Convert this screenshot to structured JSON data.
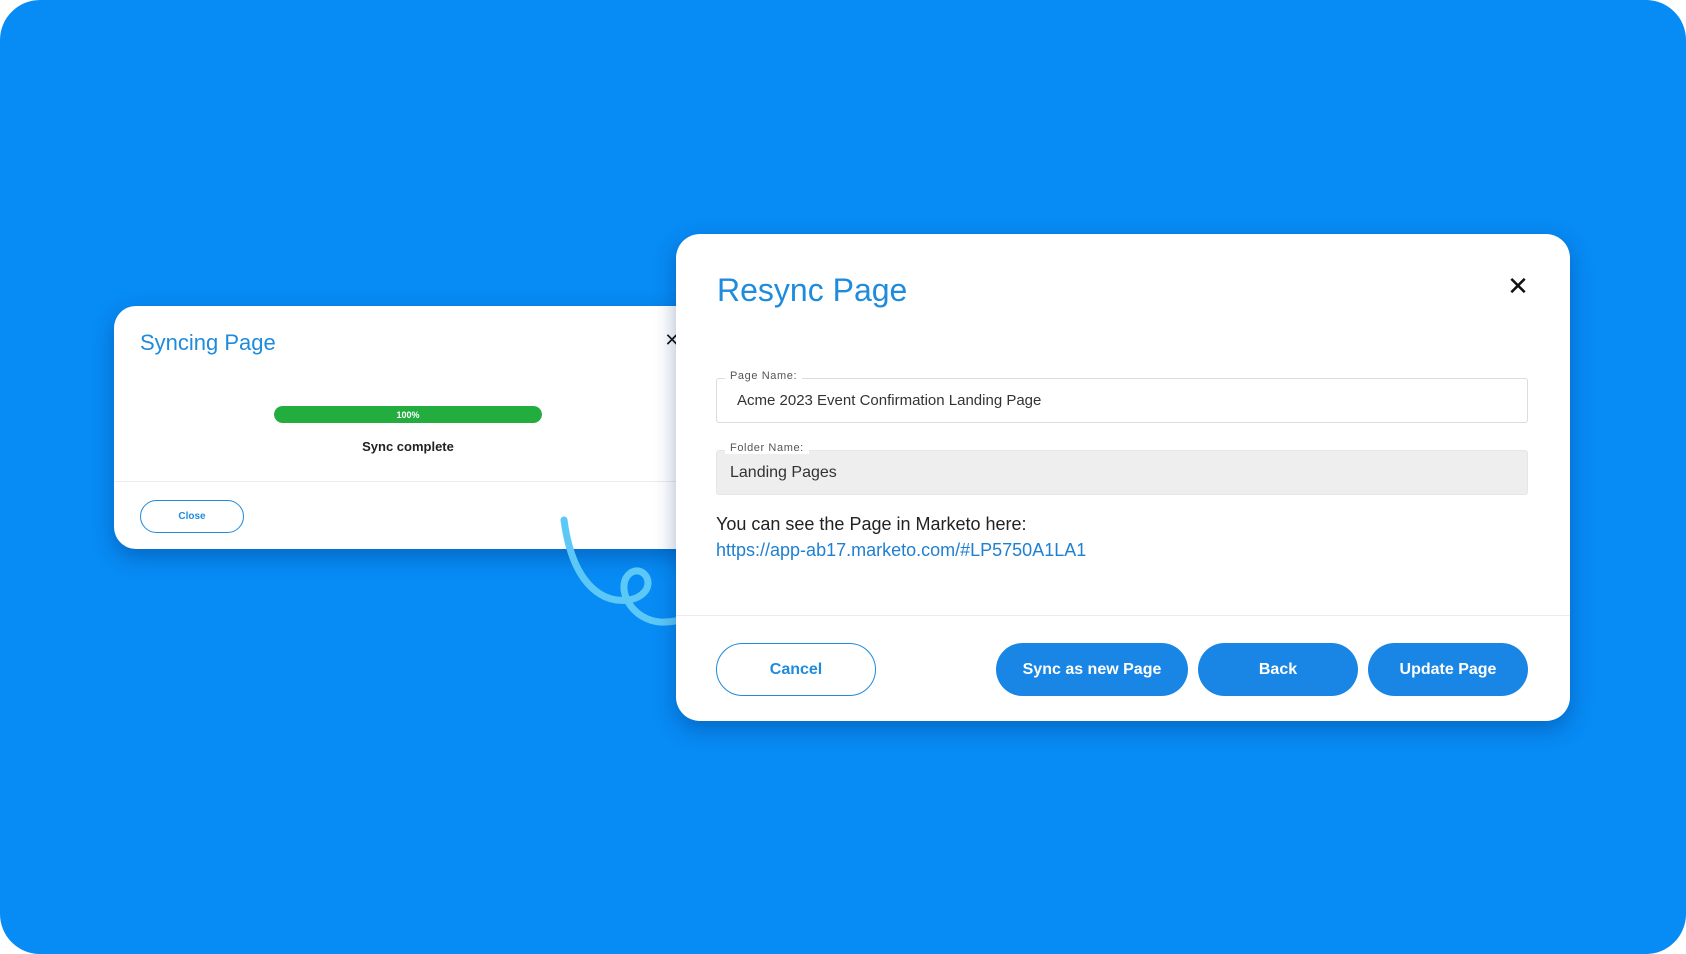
{
  "colors": {
    "background": "#078bf4",
    "accent": "#1f8bdc",
    "button_fill": "#1986e6",
    "progress": "#22ad3e"
  },
  "syncing_dialog": {
    "title": "Syncing Page",
    "progress_label": "100%",
    "progress_fraction": 1.0,
    "status": "Sync complete",
    "close_label": "Close",
    "close_icon": "close-icon"
  },
  "resync_dialog": {
    "title": "Resync Page",
    "close_icon": "close-icon",
    "page_name_label": "Page Name:",
    "page_name_value": "Acme 2023 Event Confirmation Landing Page",
    "folder_name_label": "Folder Name:",
    "folder_name_value": "Landing Pages",
    "info_text": "You can see the Page in Marketo here:",
    "link_text": "https://app-ab17.marketo.com/#LP5750A1LA1",
    "buttons": {
      "cancel": "Cancel",
      "sync_new": "Sync as new Page",
      "back": "Back",
      "update": "Update Page"
    }
  }
}
